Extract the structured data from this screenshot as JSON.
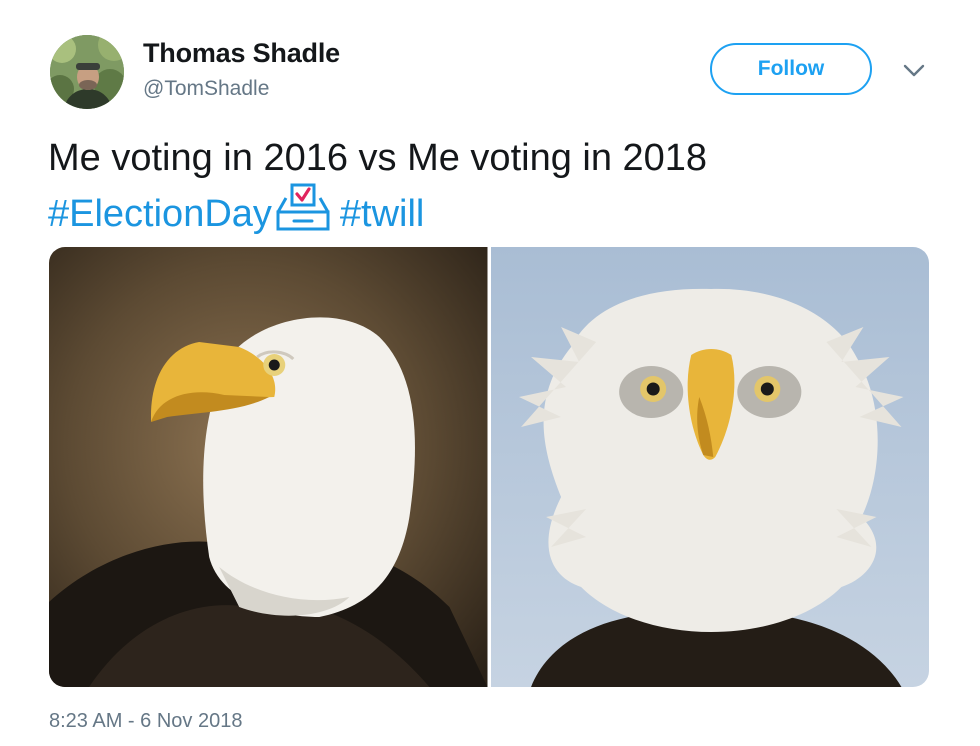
{
  "author": {
    "name": "Thomas Shadle",
    "handle": "@TomShadle",
    "avatar_icon": "profile-photo"
  },
  "header": {
    "follow_label": "Follow",
    "caret_icon": "chevron-down-icon"
  },
  "tweet": {
    "text_line1": "Me voting in 2016 vs Me voting in 2018",
    "hashtag1": "#ElectionDay",
    "emoji_icon": "ballot-box-icon",
    "hashtag2": "#twill"
  },
  "media": {
    "photos": [
      {
        "icon": "bald-eagle-calm-photo"
      },
      {
        "icon": "bald-eagle-windblown-photo"
      }
    ]
  },
  "meta": {
    "timestamp": "8:23 AM - 6 Nov 2018"
  },
  "colors": {
    "link_blue": "#1b95e0",
    "follow_blue": "#1da1f2",
    "text": "#14171a",
    "secondary_text": "#657786"
  }
}
